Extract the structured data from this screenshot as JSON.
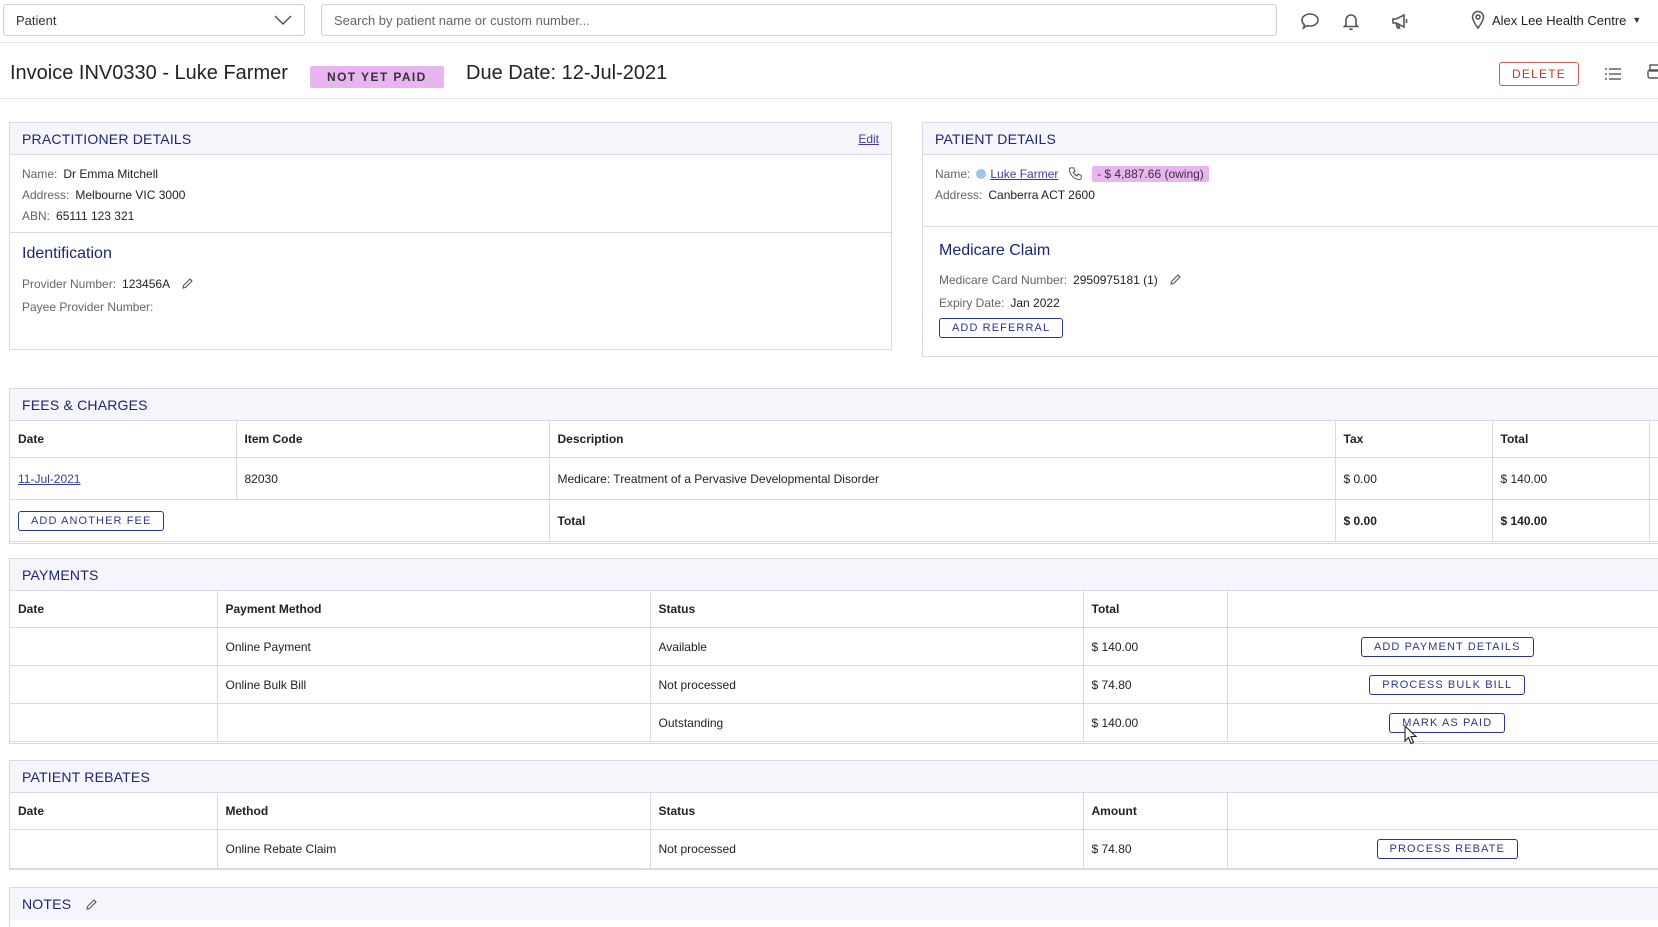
{
  "topbar": {
    "patient_select": "Patient",
    "search_placeholder": "Search by patient name or custom number...",
    "location": "Alex Lee Health Centre",
    "icons": [
      "chat-icon",
      "bell-icon",
      "megaphone-icon",
      "location-pin-icon",
      "caret-down-icon"
    ]
  },
  "header": {
    "title": "Invoice INV0330 - Luke Farmer",
    "status": "NOT YET PAID",
    "due_date": "Due Date: 12-Jul-2021",
    "delete_label": "DELETE"
  },
  "practitioner": {
    "title": "PRACTITIONER DETAILS",
    "edit_label": "Edit",
    "name_label": "Name:",
    "name": "Dr Emma Mitchell",
    "address_label": "Address:",
    "address": "Melbourne VIC 3000",
    "abn_label": "ABN:",
    "abn": "65111 123 321",
    "identification_title": "Identification",
    "provider_label": "Provider Number:",
    "provider_number": "123456A",
    "payee_label": "Payee Provider Number:"
  },
  "patient": {
    "title": "PATIENT DETAILS",
    "name_label": "Name:",
    "name": "Luke Farmer",
    "owing": "- $ 4,887.66 (owing)",
    "address_label": "Address:",
    "address": "Canberra ACT 2600",
    "medicare_title": "Medicare Claim",
    "card_label": "Medicare Card Number:",
    "card_number": "2950975181 (1)",
    "expiry_label": "Expiry Date:",
    "expiry": "Jan 2022",
    "add_referral_label": "ADD REFERRAL"
  },
  "fees": {
    "title": "FEES & CHARGES",
    "headers": {
      "date": "Date",
      "item_code": "Item Code",
      "description": "Description",
      "tax": "Tax",
      "total": "Total"
    },
    "rows": [
      {
        "date": "11-Jul-2021",
        "item_code": "82030",
        "description": "Medicare: Treatment of a Pervasive Developmental Disorder",
        "tax": "$ 0.00",
        "total": "$ 140.00"
      }
    ],
    "add_fee_label": "ADD ANOTHER FEE",
    "total_label": "Total",
    "total_tax": "$ 0.00",
    "total_amount": "$ 140.00"
  },
  "payments": {
    "title": "PAYMENTS",
    "headers": {
      "date": "Date",
      "method": "Payment Method",
      "status": "Status",
      "total": "Total"
    },
    "rows": [
      {
        "date": "",
        "method": "Online Payment",
        "status": "Available",
        "total": "$ 140.00",
        "action": "ADD PAYMENT DETAILS"
      },
      {
        "date": "",
        "method": "Online Bulk Bill",
        "status": "Not processed",
        "total": "$ 74.80",
        "action": "PROCESS BULK BILL"
      },
      {
        "date": "",
        "method": "",
        "status": "Outstanding",
        "total": "$ 140.00",
        "action": "MARK AS PAID"
      }
    ]
  },
  "rebates": {
    "title": "PATIENT REBATES",
    "headers": {
      "date": "Date",
      "method": "Method",
      "status": "Status",
      "amount": "Amount"
    },
    "rows": [
      {
        "date": "",
        "method": "Online Rebate Claim",
        "status": "Not processed",
        "amount": "$ 74.80",
        "action": "PROCESS REBATE"
      }
    ]
  },
  "notes": {
    "title": "NOTES"
  },
  "colors": {
    "accent_navy": "#1d2470",
    "badge_pink": "#e9b5f0",
    "delete_red": "#c0392b",
    "panel_header_bg": "#f6f5fc"
  }
}
